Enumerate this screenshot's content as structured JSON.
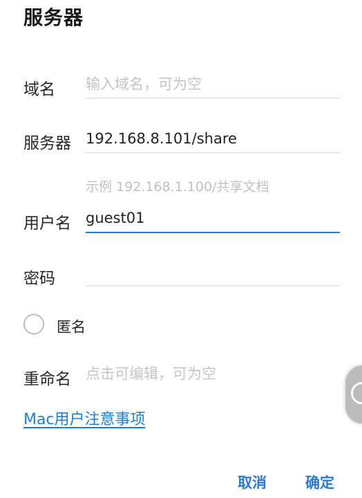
{
  "dialog": {
    "title": "服务器"
  },
  "form": {
    "domain": {
      "label": "域名",
      "value": "",
      "placeholder": "输入域名，可为空"
    },
    "server": {
      "label": "服务器",
      "value": "192.168.8.101/share",
      "hint": "示例 192.168.1.100/共享文档"
    },
    "username": {
      "label": "用户名",
      "value": "guest01"
    },
    "password": {
      "label": "密码",
      "value": ""
    },
    "anonymous": {
      "label": "匿名",
      "checked": false
    },
    "rename": {
      "label": "重命名",
      "value": "",
      "placeholder": "点击可编辑，可为空"
    }
  },
  "links": {
    "mac_notes": "Mac用户注意事项"
  },
  "buttons": {
    "cancel": "取消",
    "confirm": "确定"
  },
  "colors": {
    "accent": "#2979d6",
    "focus_underline": "#1e7ad8",
    "placeholder": "#c4c4c4"
  }
}
